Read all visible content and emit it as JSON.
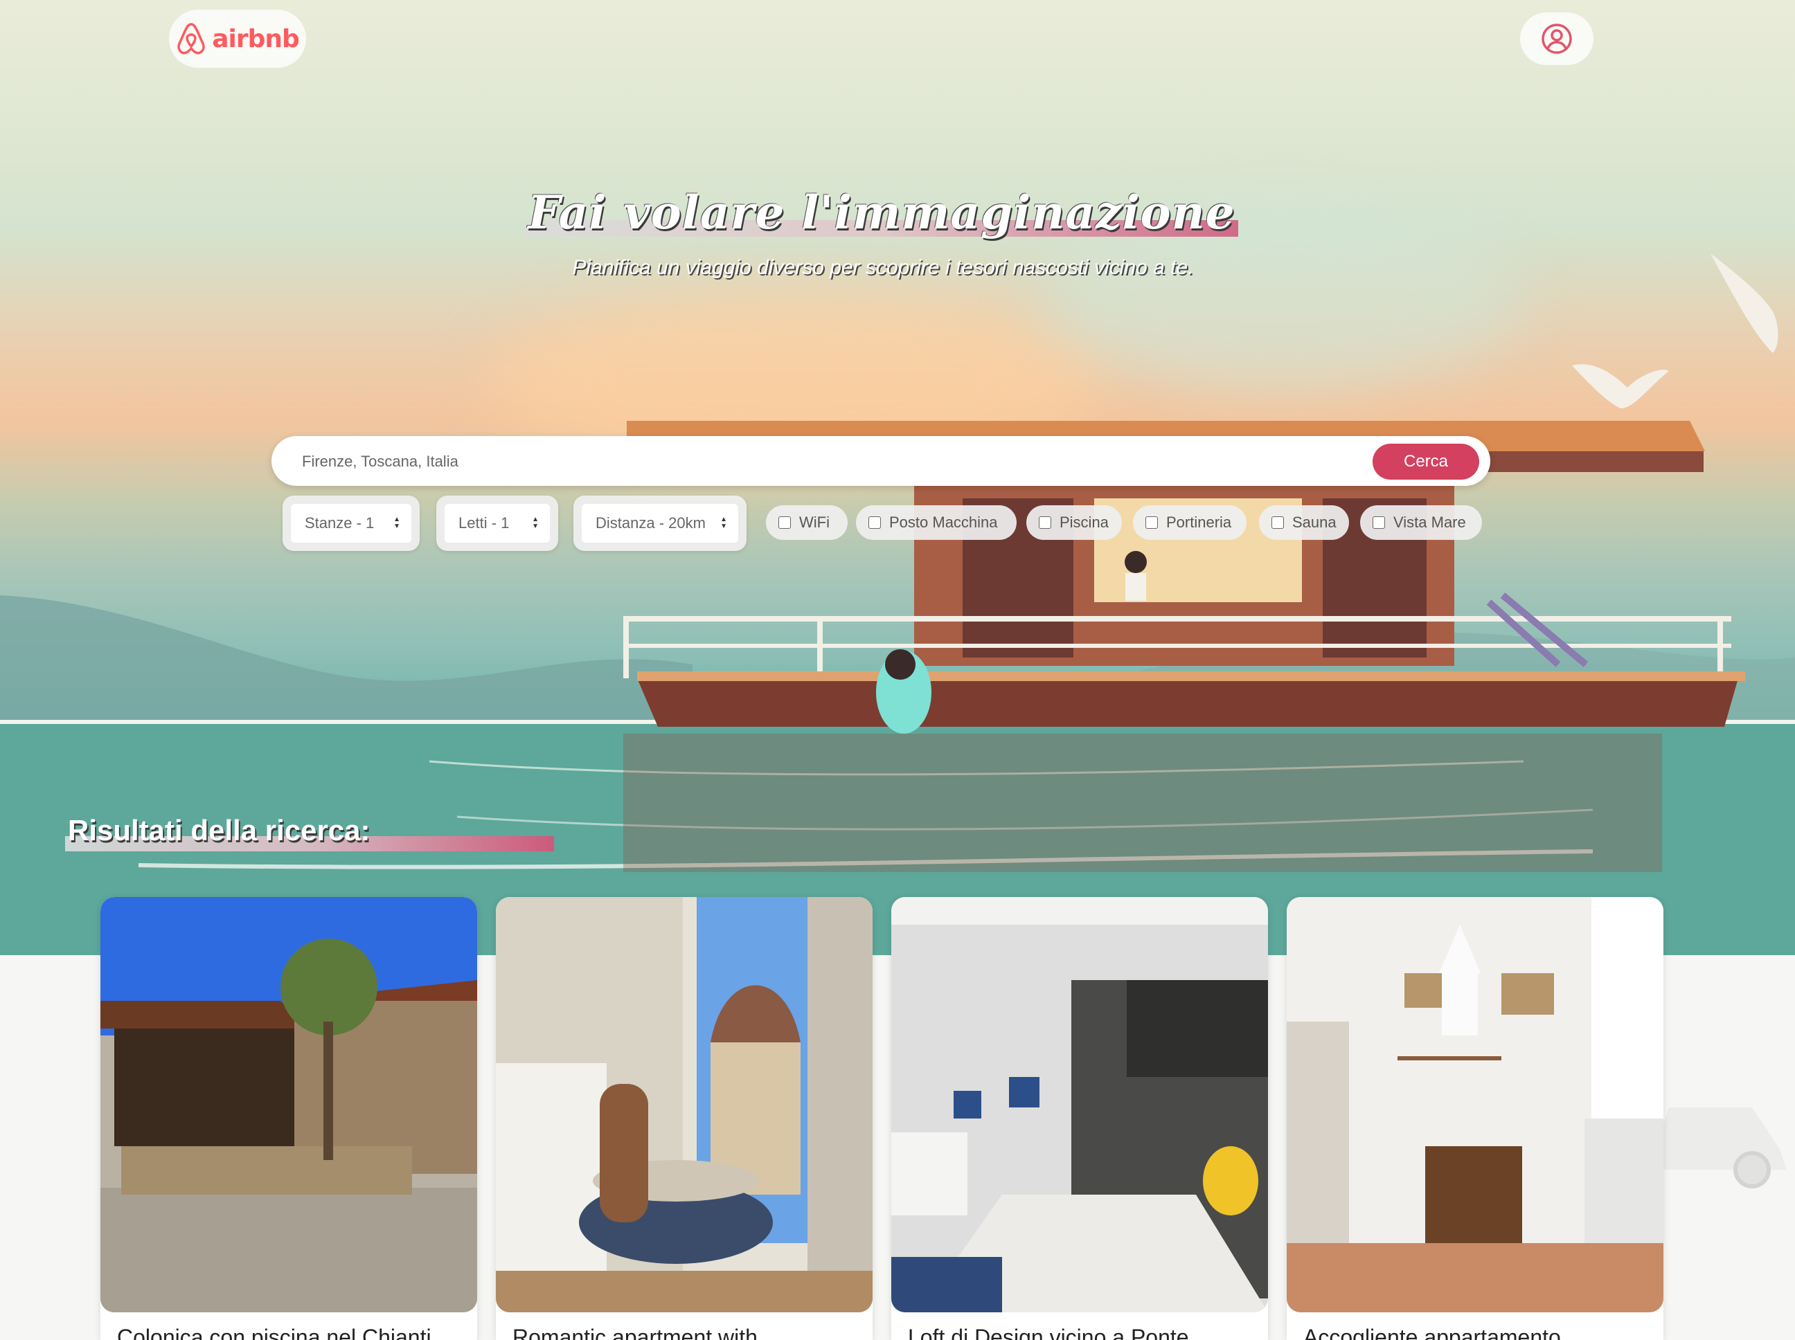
{
  "header": {
    "logo_text": "airbnb",
    "logo_icon": "airbnb-logo-icon",
    "profile_icon": "user-circle-icon"
  },
  "hero": {
    "title": "Fai volare l'immaginazione",
    "subtitle": "Pianifica un viaggio diverso per scoprire i tesori nascosti vicino a te."
  },
  "search": {
    "placeholder": "Firenze, Toscana, Italia",
    "button_label": "Cerca"
  },
  "filters": {
    "selects": [
      {
        "label": "Stanze - 1"
      },
      {
        "label": "Letti - 1"
      },
      {
        "label": "Distanza - 20km"
      }
    ],
    "checkboxes": [
      {
        "label": "WiFi",
        "checked": false
      },
      {
        "label": "Posto Macchina",
        "checked": false
      },
      {
        "label": "Piscina",
        "checked": false
      },
      {
        "label": "Portineria",
        "checked": false
      },
      {
        "label": "Sauna",
        "checked": false
      },
      {
        "label": "Vista Mare",
        "checked": false
      }
    ]
  },
  "results": {
    "heading": "Risultati della ricerca:",
    "cards": [
      {
        "title": "Colonica con piscina nel Chianti"
      },
      {
        "title": "Romantic apartment with"
      },
      {
        "title": "Loft di Design vicino a Ponte"
      },
      {
        "title": "Accogliente appartamento"
      }
    ]
  },
  "colors": {
    "brand": "#ff5a5f",
    "accent": "#d4405f"
  }
}
